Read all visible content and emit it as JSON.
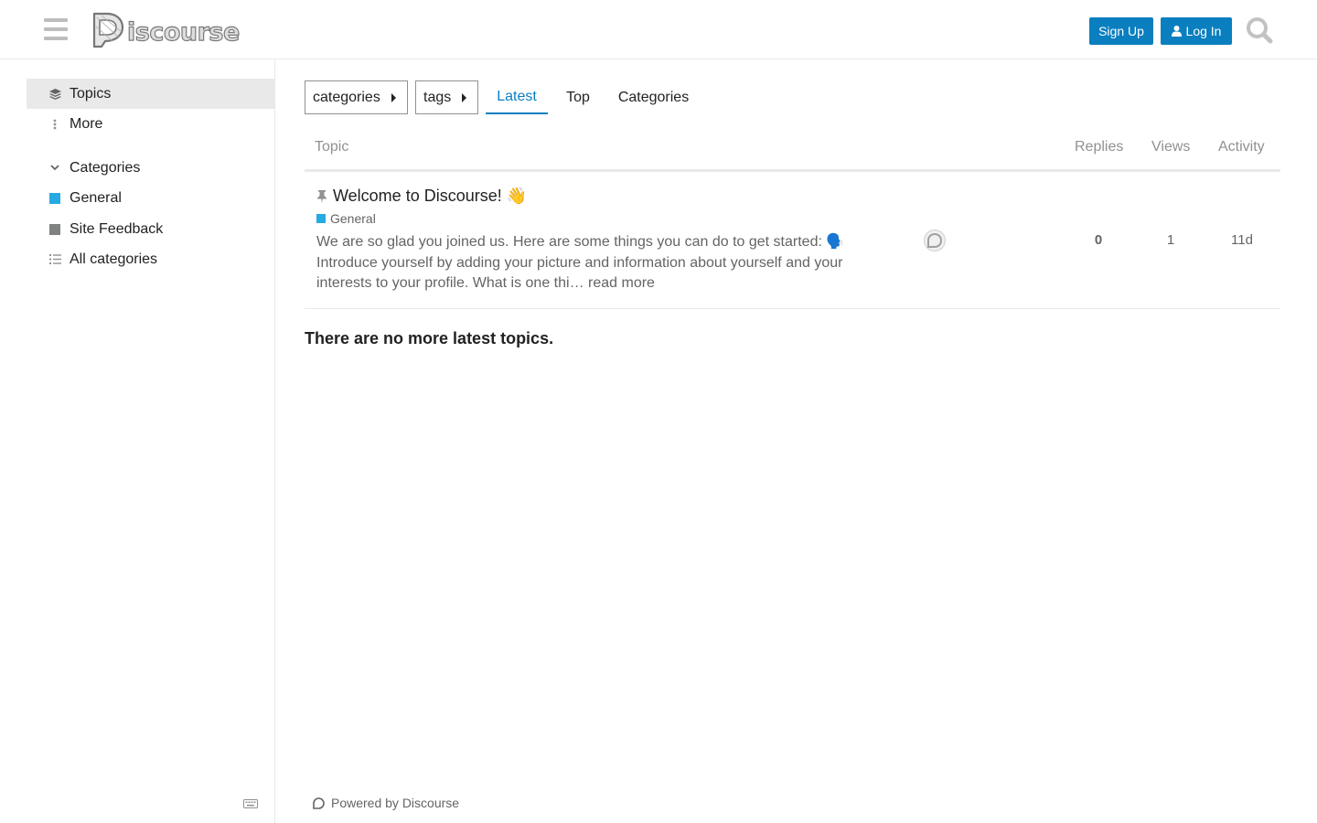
{
  "header": {
    "logo_text": "iscourse",
    "signup_label": "Sign Up",
    "login_label": "Log In"
  },
  "sidebar": {
    "topics_label": "Topics",
    "more_label": "More",
    "categories_heading": "Categories",
    "categories": [
      {
        "label": "General",
        "color": "#25aae2"
      },
      {
        "label": "Site Feedback",
        "color": "#808281"
      }
    ],
    "all_categories_label": "All categories"
  },
  "nav": {
    "categories_dropdown": "categories",
    "tags_dropdown": "tags",
    "tabs": [
      "Latest",
      "Top",
      "Categories"
    ]
  },
  "table": {
    "headers": {
      "topic": "Topic",
      "replies": "Replies",
      "views": "Views",
      "activity": "Activity"
    },
    "rows": [
      {
        "title": "Welcome to Discourse!",
        "title_emoji": "👋",
        "category": "General",
        "category_color": "#25aae2",
        "excerpt": "We are so glad you joined us. Here are some things you can do to get started: 🗣️ Introduce yourself by adding your picture and information about yourself and your interests to your profile. What is one thi…",
        "read_more": "read more",
        "replies": "0",
        "views": "1",
        "activity": "11d"
      }
    ]
  },
  "no_more_text": "There are no more latest topics.",
  "footer": {
    "powered_by": "Powered by Discourse"
  },
  "colors": {
    "accent": "#0a7fbf",
    "border": "#e9e9e9",
    "muted": "#646464"
  }
}
